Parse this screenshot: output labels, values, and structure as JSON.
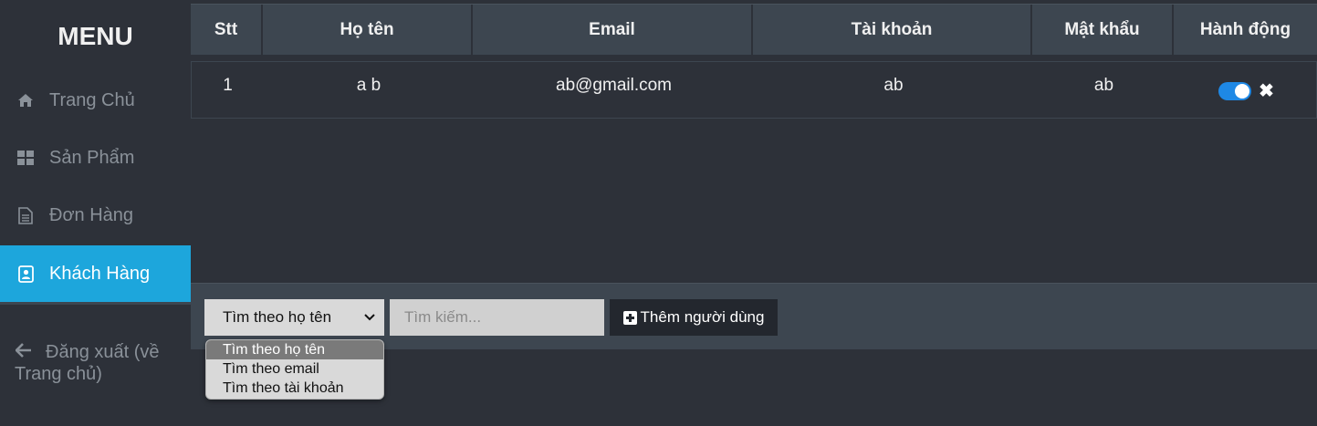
{
  "sidebar": {
    "title": "MENU",
    "items": [
      {
        "label": "Trang Chủ",
        "icon": "home-icon"
      },
      {
        "label": "Sản Phẩm",
        "icon": "grid-icon"
      },
      {
        "label": "Đơn Hàng",
        "icon": "document-icon"
      },
      {
        "label": "Khách Hàng",
        "icon": "contact-book-icon",
        "active": true
      }
    ],
    "logout": {
      "label": "Đăng xuất (về Trang chủ)",
      "icon": "arrow-left-icon"
    }
  },
  "table": {
    "columns": [
      "Stt",
      "Họ tên",
      "Email",
      "Tài khoản",
      "Mật khẩu",
      "Hành động"
    ],
    "rows": [
      {
        "stt": "1",
        "name": "a b",
        "email": "ab@gmail.com",
        "username": "ab",
        "password": "ab",
        "enabled": true
      }
    ]
  },
  "toolbar": {
    "select_value": "Tìm theo họ tên",
    "search_placeholder": "Tìm kiếm...",
    "add_label": "Thêm người dùng"
  },
  "dropdown": {
    "options": [
      "Tìm theo họ tên",
      "Tìm theo email",
      "Tìm theo tài khoản"
    ],
    "selected_index": 0
  },
  "colors": {
    "background": "#2d3139",
    "header": "#3d4650",
    "accent": "#1da6dc",
    "toggle": "#1e88e5"
  }
}
